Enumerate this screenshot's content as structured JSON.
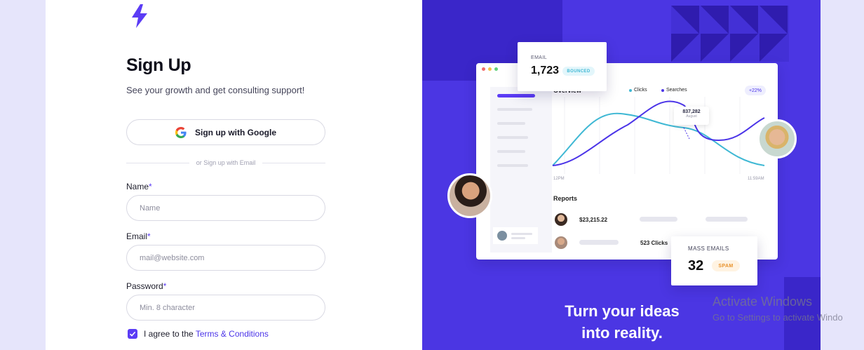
{
  "signup": {
    "title": "Sign Up",
    "subtitle": "See your growth and get consulting support!",
    "google_button": "Sign up with Google",
    "divider": "or Sign up with Email",
    "name_label": "Name",
    "name_placeholder": "Name",
    "email_label": "Email",
    "email_placeholder": "mail@website.com",
    "password_label": "Password",
    "password_placeholder": "Min. 8 character",
    "required_mark": "*",
    "agree_text": "I agree to the ",
    "terms_link": "Terms & Conditions",
    "agree_checked": true
  },
  "promo": {
    "email_card": {
      "label": "EMAIL",
      "value": "1,723",
      "badge": "BOUNCED"
    },
    "dashboard": {
      "overview": "Overview",
      "legend": [
        "Clicks",
        "Searches"
      ],
      "change": "+22%",
      "tooltip_value": "837,282",
      "tooltip_month": "August",
      "x_start": "12PM",
      "x_end": "11:59AM",
      "reports_title": "Reports",
      "report_amount": "$23,215.22",
      "report_clicks": "523 Clicks"
    },
    "mass_card": {
      "label": "MASS EMAILS",
      "value": "32",
      "badge": "SPAM"
    },
    "tagline_line1": "Turn your ideas",
    "tagline_line2": "into reality."
  },
  "colors": {
    "accent": "#5b3cf5",
    "panel": "#4b36e3",
    "teal": "#3fb8d4"
  },
  "watermark": {
    "line1": "Activate Windows",
    "line2": "Go to Settings to activate Windo"
  }
}
